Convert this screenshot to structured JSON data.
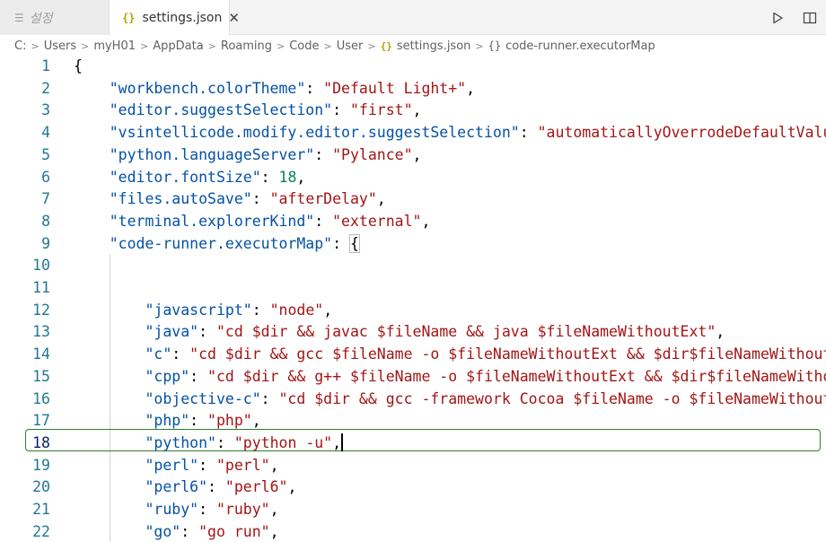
{
  "tabs": {
    "settings_ui": {
      "label": "설정",
      "icon": "settings-lines-icon"
    },
    "settings_json": {
      "label": "settings.json",
      "icon": "braces-icon",
      "close": "✕"
    }
  },
  "actions": {
    "run": "run-play-icon",
    "split": "split-editor-icon"
  },
  "breadcrumb": {
    "items": [
      "C:",
      "Users",
      "myH01",
      "AppData",
      "Roaming",
      "Code",
      "User",
      "settings.json",
      "code-runner.executorMap"
    ],
    "json_icon": "{}",
    "object_icon": "{}"
  },
  "lines": [
    {
      "n": "1"
    },
    {
      "n": "2"
    },
    {
      "n": "3"
    },
    {
      "n": "4"
    },
    {
      "n": "5"
    },
    {
      "n": "6"
    },
    {
      "n": "7"
    },
    {
      "n": "8"
    },
    {
      "n": "9"
    },
    {
      "n": "10"
    },
    {
      "n": "11"
    },
    {
      "n": "12"
    },
    {
      "n": "13"
    },
    {
      "n": "14"
    },
    {
      "n": "15"
    },
    {
      "n": "16"
    },
    {
      "n": "17"
    },
    {
      "n": "18"
    },
    {
      "n": "19"
    },
    {
      "n": "20"
    },
    {
      "n": "21"
    },
    {
      "n": "22"
    }
  ],
  "code": {
    "l1": "{",
    "l2": {
      "key": "\"workbench.colorTheme\"",
      "val": "\"Default Light+\""
    },
    "l3": {
      "key": "\"editor.suggestSelection\"",
      "val": "\"first\""
    },
    "l4": {
      "key": "\"vsintellicode.modify.editor.suggestSelection\"",
      "val": "\"automaticallyOverrodeDefaultValue\""
    },
    "l5": {
      "key": "\"python.languageServer\"",
      "val": "\"Pylance\""
    },
    "l6": {
      "key": "\"editor.fontSize\"",
      "val": "18"
    },
    "l7": {
      "key": "\"files.autoSave\"",
      "val": "\"afterDelay\""
    },
    "l8": {
      "key": "\"terminal.explorerKind\"",
      "val": "\"external\""
    },
    "l9": {
      "key": "\"code-runner.executorMap\"",
      "val": "{"
    },
    "l12": {
      "key": "\"javascript\"",
      "val": "\"node\""
    },
    "l13": {
      "key": "\"java\"",
      "val": "\"cd $dir && javac $fileName && java $fileNameWithoutExt\""
    },
    "l14": {
      "key": "\"c\"",
      "val": "\"cd $dir && gcc $fileName -o $fileNameWithoutExt && $dir$fileNameWithoutExt\""
    },
    "l15": {
      "key": "\"cpp\"",
      "val": "\"cd $dir && g++ $fileName -o $fileNameWithoutExt && $dir$fileNameWithoutExt\""
    },
    "l16": {
      "key": "\"objective-c\"",
      "val": "\"cd $dir && gcc -framework Cocoa $fileName -o $fileNameWithoutExt\""
    },
    "l17": {
      "key": "\"php\"",
      "val": "\"php\""
    },
    "l18": {
      "key": "\"python\"",
      "val": "\"python -u\""
    },
    "l19": {
      "key": "\"perl\"",
      "val": "\"perl\""
    },
    "l20": {
      "key": "\"perl6\"",
      "val": "\"perl6\""
    },
    "l21": {
      "key": "\"ruby\"",
      "val": "\"ruby\""
    },
    "l22": {
      "key": "\"go\"",
      "val": "\"go run\""
    }
  },
  "colors": {
    "key": "#0451a5",
    "string": "#a31515",
    "number": "#098658",
    "line_number": "#237893",
    "highlight": "#2d7d2d"
  }
}
